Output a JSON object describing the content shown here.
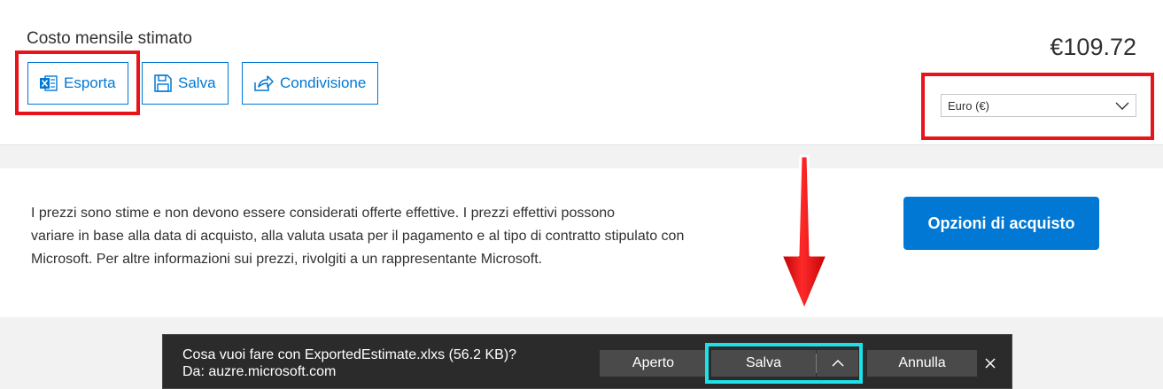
{
  "summary": {
    "title": "Costo mensile stimato",
    "total": "€109.72",
    "actions": {
      "export_label": "Esporta",
      "save_label": "Salva",
      "share_label": "Condivisione"
    },
    "currency": {
      "selected": "Euro (€)"
    }
  },
  "disclaimer": {
    "lines": [
      "I prezzi sono stime e non devono essere considerati offerte effettive. I prezzi effettivi possono",
      "variare in base alla data di acquisto, alla valuta usata per il pagamento e al tipo di contratto stipulato con",
      "Microsoft. Per altre informazioni sui prezzi, rivolgiti a un rappresentante Microsoft."
    ],
    "purchase_label": "Opzioni di acquisto"
  },
  "download_bar": {
    "question": "Cosa vuoi fare con ExportedEstimate.xlxs (56.2 KB)?",
    "source": "Da: auzre.microsoft.com",
    "open_label": "Aperto",
    "save_label": "Salva",
    "cancel_label": "Annulla"
  },
  "colors": {
    "accent": "#0078d4",
    "highlight_red": "#e8141c",
    "highlight_cyan": "#1ce1e8",
    "download_bar_bg": "#2b2b2b"
  },
  "icons": [
    "excel-icon",
    "floppy-disk-icon",
    "share-icon",
    "chevron-down-icon",
    "chevron-up-icon",
    "close-icon",
    "red-down-arrow-annotation"
  ]
}
